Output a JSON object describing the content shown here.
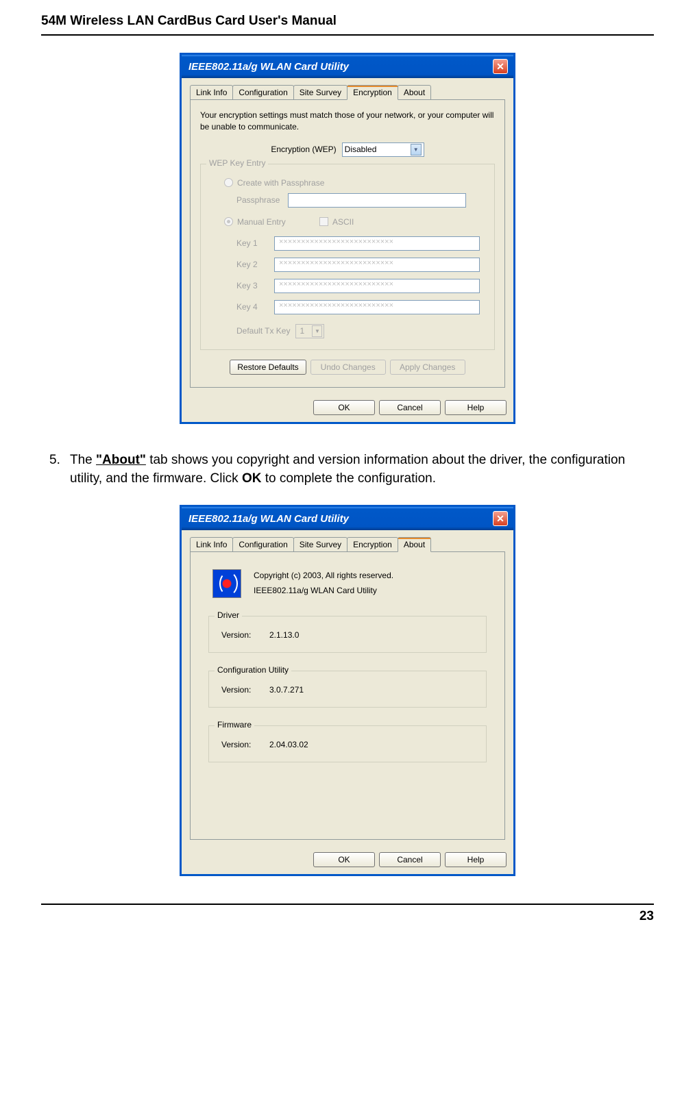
{
  "page": {
    "header": "54M Wireless LAN CardBus Card User's Manual",
    "pageNumber": "23"
  },
  "step": {
    "number": "5.",
    "prefix": "The ",
    "bold1": "\"About\"",
    "mid1": " tab shows you copyright and version information about the driver, the configuration utility, and the firmware. Click ",
    "bold2": "OK",
    "suffix": " to complete the configuration."
  },
  "dialog1": {
    "title": "IEEE802.11a/g WLAN Card Utility",
    "tabs": [
      "Link Info",
      "Configuration",
      "Site Survey",
      "Encryption",
      "About"
    ],
    "activeTab": "Encryption",
    "intro": "Your encryption settings must match those of your network, or your computer will be unable to communicate.",
    "encLabel": "Encryption (WEP)",
    "encValue": "Disabled",
    "wepGroup": "WEP Key Entry",
    "radioPass": "Create with Passphrase",
    "passLabel": "Passphrase",
    "radioManual": "Manual Entry",
    "asciiLabel": "ASCII",
    "key1": "Key 1",
    "key2": "Key 2",
    "key3": "Key 3",
    "key4": "Key 4",
    "keyMask": "××××××××××××××××××××××××××",
    "defaultTx": "Default Tx Key",
    "defaultTxVal": "1",
    "btnRestore": "Restore Defaults",
    "btnUndo": "Undo Changes",
    "btnApply": "Apply Changes",
    "btnOK": "OK",
    "btnCancel": "Cancel",
    "btnHelp": "Help"
  },
  "dialog2": {
    "title": "IEEE802.11a/g WLAN Card Utility",
    "tabs": [
      "Link Info",
      "Configuration",
      "Site Survey",
      "Encryption",
      "About"
    ],
    "activeTab": "About",
    "copyright": "Copyright (c) 2003, All rights reserved.",
    "product": "IEEE802.11a/g WLAN Card Utility",
    "driverGroup": "Driver",
    "driverLabel": "Version:",
    "driverVal": "2.1.13.0",
    "configGroup": "Configuration Utility",
    "configLabel": "Version:",
    "configVal": "3.0.7.271",
    "fwGroup": "Firmware",
    "fwLabel": "Version:",
    "fwVal": "2.04.03.02",
    "btnOK": "OK",
    "btnCancel": "Cancel",
    "btnHelp": "Help"
  }
}
